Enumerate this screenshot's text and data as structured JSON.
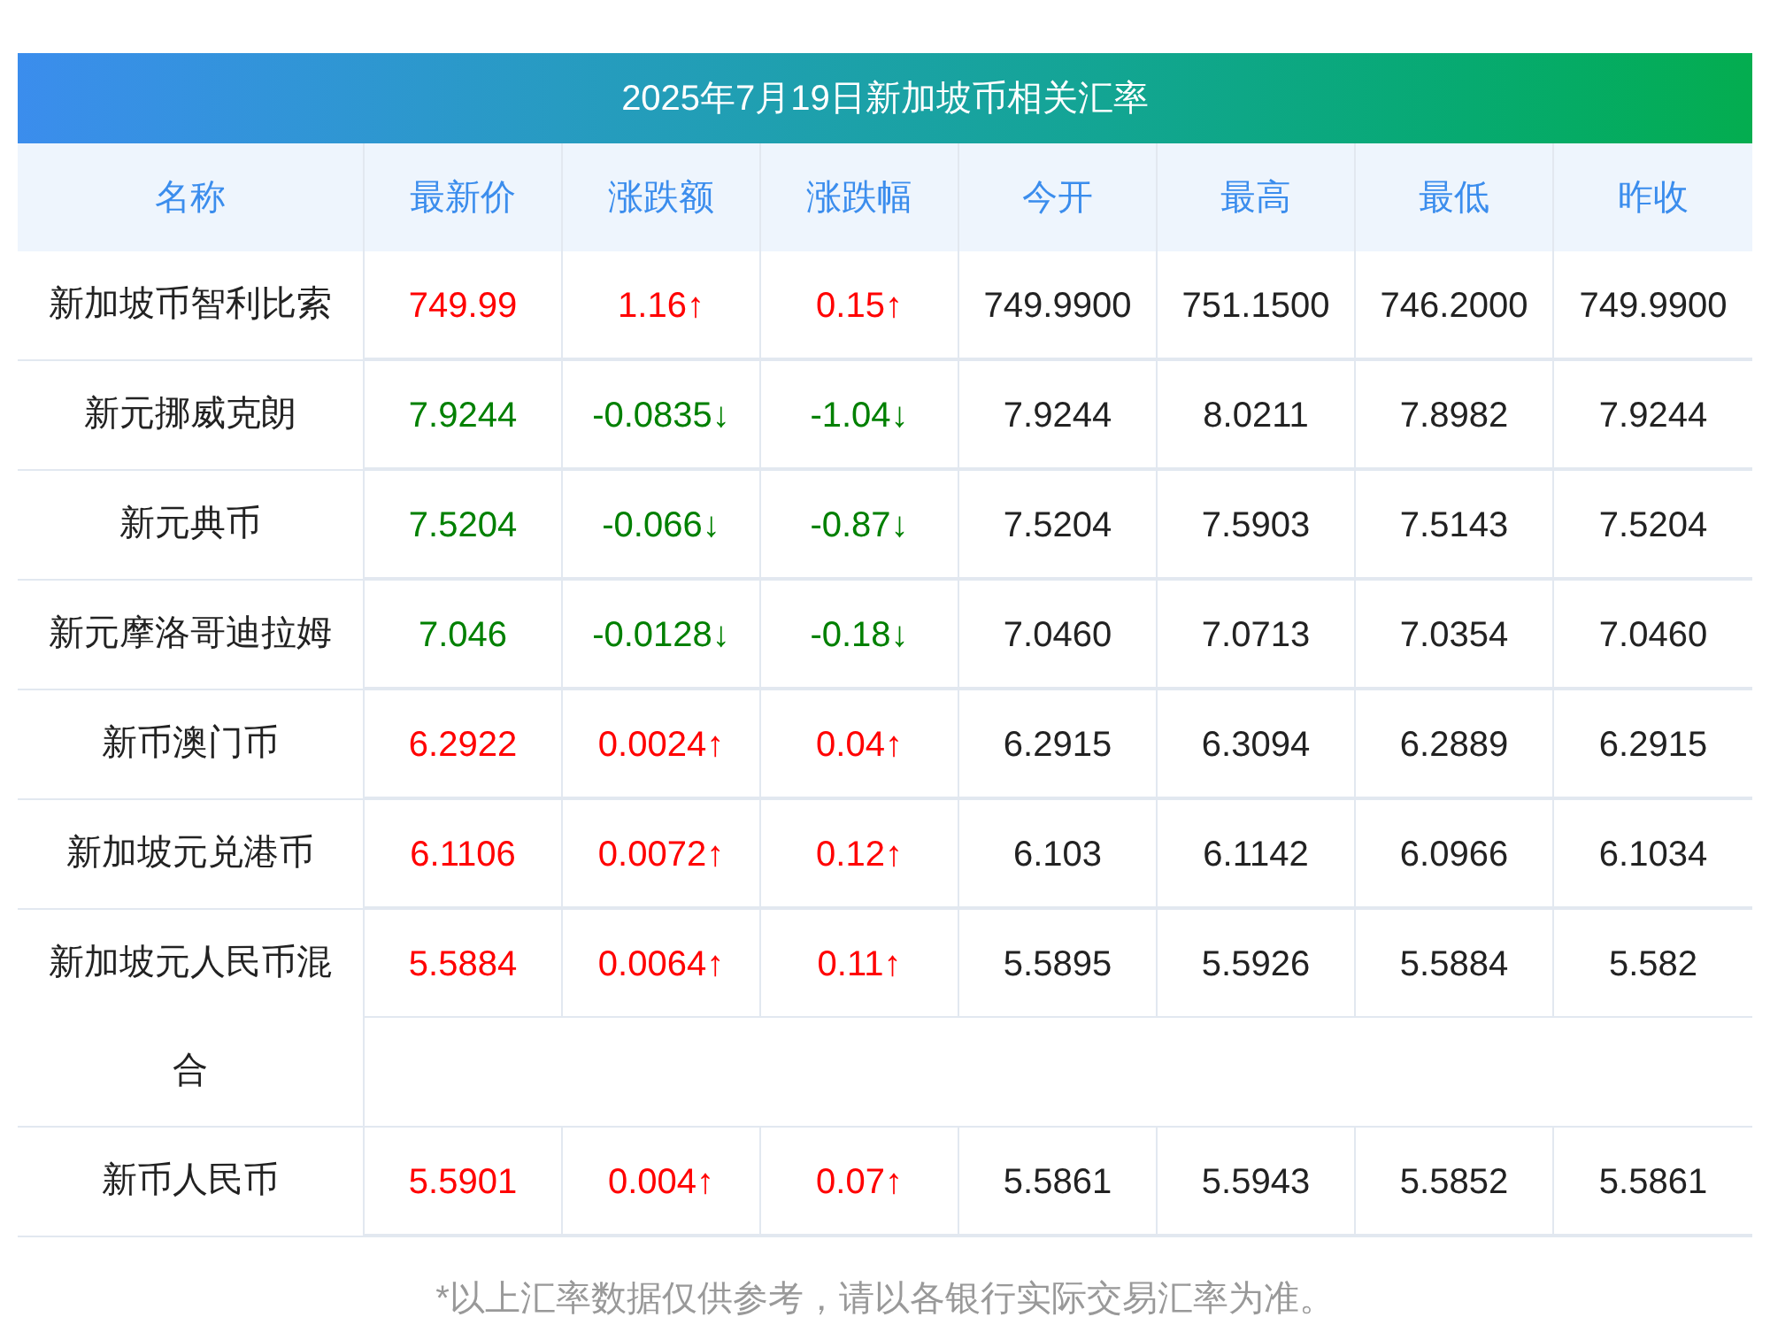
{
  "title": "2025年7月19日新加坡币相关汇率",
  "columns": [
    "名称",
    "最新价",
    "涨跌额",
    "涨跌幅",
    "今开",
    "最高",
    "最低",
    "昨收"
  ],
  "rows": [
    {
      "name": "新加坡币智利比索",
      "rising": true,
      "latest": "749.99",
      "change": "1.16↑",
      "change_pct": "0.15↑",
      "open": "749.9900",
      "high": "751.1500",
      "low": "746.2000",
      "prev_close": "749.9900"
    },
    {
      "name": "新元挪威克朗",
      "rising": false,
      "latest": "7.9244",
      "change": "-0.0835↓",
      "change_pct": "-1.04↓",
      "open": "7.9244",
      "high": "8.0211",
      "low": "7.8982",
      "prev_close": "7.9244"
    },
    {
      "name": "新元典币",
      "rising": false,
      "latest": "7.5204",
      "change": "-0.066↓",
      "change_pct": "-0.87↓",
      "open": "7.5204",
      "high": "7.5903",
      "low": "7.5143",
      "prev_close": "7.5204"
    },
    {
      "name": "新元摩洛哥迪拉姆",
      "rising": false,
      "latest": "7.046",
      "change": "-0.0128↓",
      "change_pct": "-0.18↓",
      "open": "7.0460",
      "high": "7.0713",
      "low": "7.0354",
      "prev_close": "7.0460"
    },
    {
      "name": "新币澳门币",
      "rising": true,
      "latest": "6.2922",
      "change": "0.0024↑",
      "change_pct": "0.04↑",
      "open": "6.2915",
      "high": "6.3094",
      "low": "6.2889",
      "prev_close": "6.2915"
    },
    {
      "name": "新加坡元兑港币",
      "rising": true,
      "latest": "6.1106",
      "change": "0.0072↑",
      "change_pct": "0.12↑",
      "open": "6.103",
      "high": "6.1142",
      "low": "6.0966",
      "prev_close": "6.1034"
    },
    {
      "name": "新加坡元人民币混合",
      "rising": true,
      "latest": "5.5884",
      "change": "0.0064↑",
      "change_pct": "0.11↑",
      "open": "5.5895",
      "high": "5.5926",
      "low": "5.5884",
      "prev_close": "5.582"
    },
    {
      "name": "新币人民币",
      "rising": true,
      "latest": "5.5901",
      "change": "0.004↑",
      "change_pct": "0.07↑",
      "open": "5.5861",
      "high": "5.5943",
      "low": "5.5852",
      "prev_close": "5.5861"
    }
  ],
  "footnote": "*以上汇率数据仅供参考，请以各银行实际交易汇率为准。"
}
